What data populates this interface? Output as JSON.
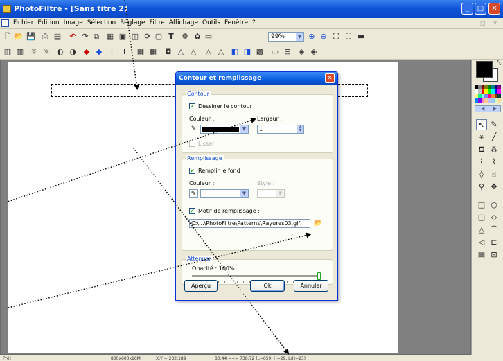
{
  "window": {
    "title": "PhotoFiltre - [Sans titre 2]"
  },
  "menu": {
    "items": [
      "Fichier",
      "Edition",
      "Image",
      "Sélection",
      "Réglage",
      "Filtre",
      "Affichage",
      "Outils",
      "Fenêtre",
      "?"
    ]
  },
  "toolbar": {
    "zoom_value": "99%"
  },
  "dialog": {
    "title": "Contour et remplissage",
    "contour": {
      "group_label": "Contour",
      "draw_label": "Dessiner le contour",
      "draw_checked": true,
      "color_label": "Couleur :",
      "color_value": "#000000",
      "width_label": "Largeur :",
      "width_value": "1",
      "smooth_label": "Lisser",
      "smooth_checked": false
    },
    "fill": {
      "group_label": "Remplissage",
      "fill_label": "Remplir le fond",
      "fill_checked": true,
      "color_label": "Couleur :",
      "color_value": "#ffffff",
      "style_label": "Style :",
      "pattern_label": "Motif de remplissage :",
      "pattern_checked": true,
      "pattern_path": "C:\\...\\PhotoFiltre\\Patterns\\Rayures03.gif"
    },
    "attenuate": {
      "group_label": "Atténuer",
      "opacity_label": "Opacité : 100%",
      "opacity_value": 100
    },
    "buttons": {
      "preview": "Aperçu",
      "ok": "Ok",
      "cancel": "Annuler"
    }
  },
  "status": {
    "ready": "Prêt",
    "image_size": "800x600x16M",
    "cursor": "X:Y = 232:189",
    "selection": "80:44 ==> 738:72 (L=659, H=29, L/H=23)"
  },
  "palette": {
    "foreground": "#000000",
    "background": "#ffffff",
    "swatches": [
      "#000000",
      "#808080",
      "#800000",
      "#808000",
      "#008000",
      "#008080",
      "#000080",
      "#800080",
      "#ffffff",
      "#c0c0c0",
      "#ff0000",
      "#ffff00",
      "#00ff00",
      "#00ffff",
      "#0000ff",
      "#ff00ff",
      "#ffff80",
      "#00ff80",
      "#80ffff",
      "#8080ff",
      "#ff0080",
      "#ff8040",
      "#804000",
      "#004040",
      "#0080ff",
      "#8000ff",
      "#ff80c0",
      "#ffcc99",
      "#c0c0ff",
      "#99ccff",
      "#ccffcc",
      "#ffe0a0"
    ]
  }
}
